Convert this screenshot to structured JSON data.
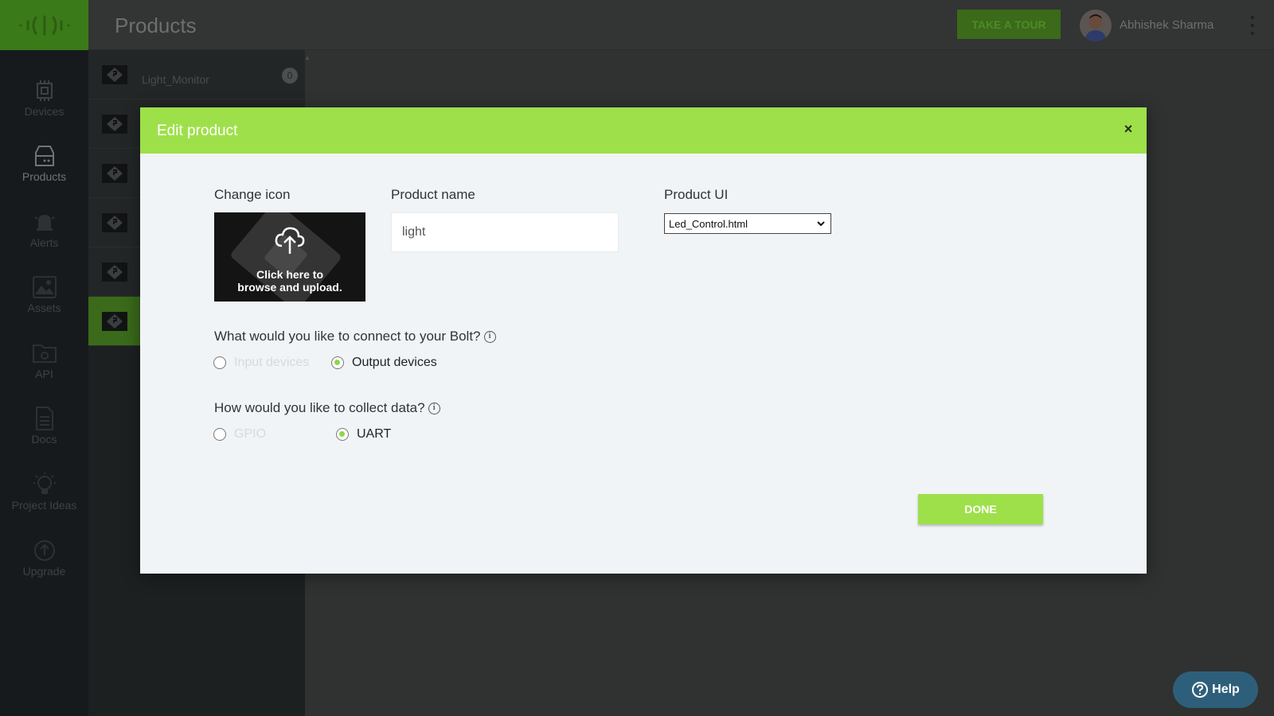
{
  "header": {
    "title": "Products",
    "tour_label": "TAKE A TOUR",
    "user_name": "Abhishek Sharma"
  },
  "nav": {
    "items": [
      {
        "label": "Devices",
        "icon": "chip-icon"
      },
      {
        "label": "Products",
        "icon": "product-box-icon"
      },
      {
        "label": "Alerts",
        "icon": "bell-icon"
      },
      {
        "label": "Assets",
        "icon": "image-icon"
      },
      {
        "label": "API",
        "icon": "api-folder-icon"
      },
      {
        "label": "Docs",
        "icon": "document-icon"
      },
      {
        "label": "Project Ideas",
        "icon": "lightbulb-icon"
      },
      {
        "label": "Upgrade",
        "icon": "upgrade-icon"
      }
    ]
  },
  "products": {
    "first_name": "Light_Monitor",
    "first_count": "0"
  },
  "modal": {
    "title": "Edit product",
    "close_glyph": "×",
    "change_icon_label": "Change icon",
    "upload_line1": "Click here to",
    "upload_line2": "browse and upload.",
    "product_name_label": "Product name",
    "product_name_value": "light",
    "product_ui_label": "Product UI",
    "product_ui_value": "Led_Control.html",
    "connect_question": "What would you like to connect to your Bolt?",
    "connect_options": [
      "Input devices",
      "Output devices"
    ],
    "collect_question": "How would you like to collect data?",
    "collect_options": [
      "GPIO",
      "UART"
    ],
    "info_glyph": "i",
    "done_label": "DONE"
  },
  "help": {
    "label": "Help"
  },
  "colors": {
    "accent_green": "#9ee04a",
    "nav_bg": "#171a1c",
    "help_blue": "#2e5f7a"
  }
}
